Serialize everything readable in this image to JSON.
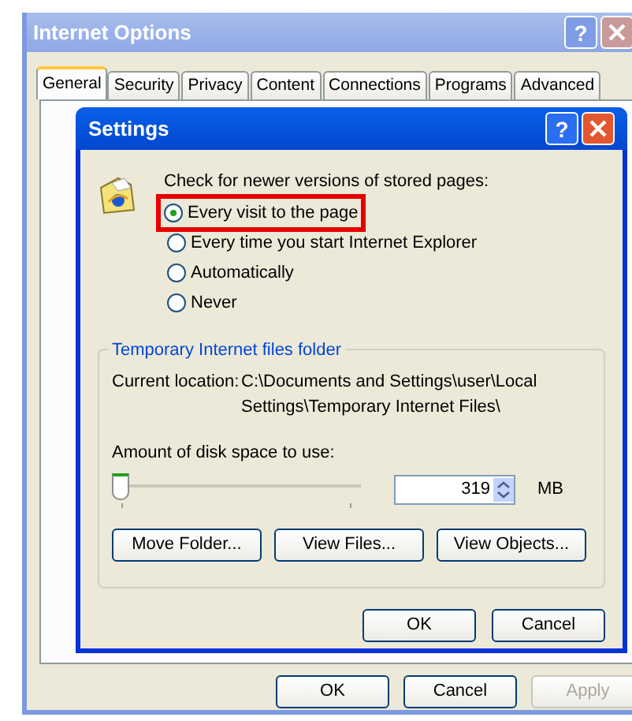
{
  "window": {
    "title": "Internet Options",
    "help": "?",
    "tabs": [
      {
        "label": "General",
        "selected": true
      },
      {
        "label": "Security",
        "selected": false
      },
      {
        "label": "Privacy",
        "selected": false
      },
      {
        "label": "Content",
        "selected": false
      },
      {
        "label": "Connections",
        "selected": false
      },
      {
        "label": "Programs",
        "selected": false
      },
      {
        "label": "Advanced",
        "selected": false
      }
    ],
    "buttons": [
      {
        "label": "OK",
        "disabled": false
      },
      {
        "label": "Cancel",
        "disabled": false
      },
      {
        "label": "Apply",
        "disabled": true
      }
    ]
  },
  "dialog": {
    "title": "Settings",
    "help": "?",
    "check_heading": "Check for newer versions of stored pages:",
    "options": [
      {
        "label": "Every visit to the page",
        "selected": true,
        "highlighted": true
      },
      {
        "label": "Every time you start Internet Explorer",
        "selected": false,
        "highlighted": false
      },
      {
        "label": "Automatically",
        "selected": false,
        "highlighted": false
      },
      {
        "label": "Never",
        "selected": false,
        "highlighted": false
      }
    ],
    "folder_group": {
      "title": "Temporary Internet files folder",
      "location_label": "Current location:",
      "location_lines": [
        "C:\\Documents and Settings\\user\\Local",
        "Settings\\Temporary Internet Files\\"
      ],
      "disk_label": "Amount of disk space to use:",
      "slider": {
        "level": 0
      },
      "size": "319",
      "unit": "MB",
      "buttons": [
        "Move Folder...",
        "View Files...",
        "View Objects..."
      ]
    },
    "buttons": [
      "OK",
      "Cancel"
    ]
  }
}
